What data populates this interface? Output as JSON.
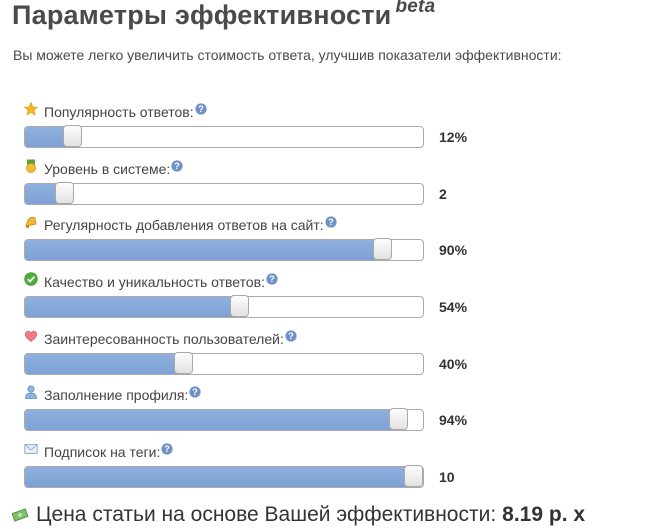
{
  "header": {
    "title": "Параметры эффективности",
    "badge": "beta"
  },
  "intro": "Вы можете легко увеличить стоимость ответа, улучшив показатели эффективности:",
  "metrics": [
    {
      "label": "Популярность ответов:",
      "value_text": "12%",
      "fraction": 0.12,
      "icon": "star-icon"
    },
    {
      "label": "Уровень в системе:",
      "value_text": "2",
      "fraction": 0.1,
      "icon": "level-badge-icon"
    },
    {
      "label": "Регулярность добавления ответов на сайт:",
      "value_text": "90%",
      "fraction": 0.9,
      "icon": "bell-icon"
    },
    {
      "label": "Качество и уникальность ответов:",
      "value_text": "54%",
      "fraction": 0.54,
      "icon": "check-circle-icon"
    },
    {
      "label": "Заинтересованность пользователей:",
      "value_text": "40%",
      "fraction": 0.4,
      "icon": "heart-icon"
    },
    {
      "label": "Заполнение профиля:",
      "value_text": "94%",
      "fraction": 0.94,
      "icon": "user-icon"
    },
    {
      "label": "Подписок на теги:",
      "value_text": "10",
      "fraction": 1.0,
      "icon": "envelope-icon"
    }
  ],
  "price": {
    "label": "Цена статьи на основе Вашей эффективности:",
    "amount": "8.19 р. х",
    "icon": "money-icon"
  },
  "colors": {
    "fill": "#7ea2d6",
    "help_icon": "#6f93c8"
  }
}
